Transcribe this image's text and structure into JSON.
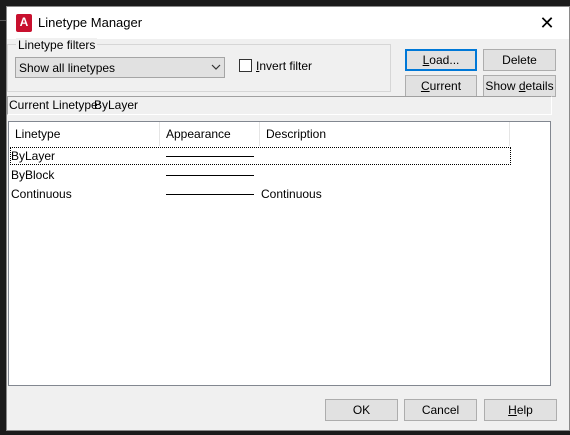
{
  "dialog": {
    "title": "Linetype Manager",
    "app_icon_letter": "A",
    "close_glyph": "✕"
  },
  "filters": {
    "group_label": "Linetype filters",
    "selected": "Show all linetypes",
    "invert_label": "Invert filter",
    "invert_checked": false
  },
  "buttons": {
    "load": "Load...",
    "delete": "Delete",
    "current": "Current",
    "show_details": "Show details",
    "ok": "OK",
    "cancel": "Cancel",
    "help": "Help"
  },
  "current_linetype": {
    "label": "Current Linetype:",
    "value": "ByLayer"
  },
  "list": {
    "columns": [
      "Linetype",
      "Appearance",
      "Description"
    ],
    "rows": [
      {
        "linetype": "ByLayer",
        "description": ""
      },
      {
        "linetype": "ByBlock",
        "description": ""
      },
      {
        "linetype": "Continuous",
        "description": "Continuous"
      }
    ]
  },
  "colors": {
    "focus_border": "#0078d7",
    "app_icon": "#c8102e"
  }
}
